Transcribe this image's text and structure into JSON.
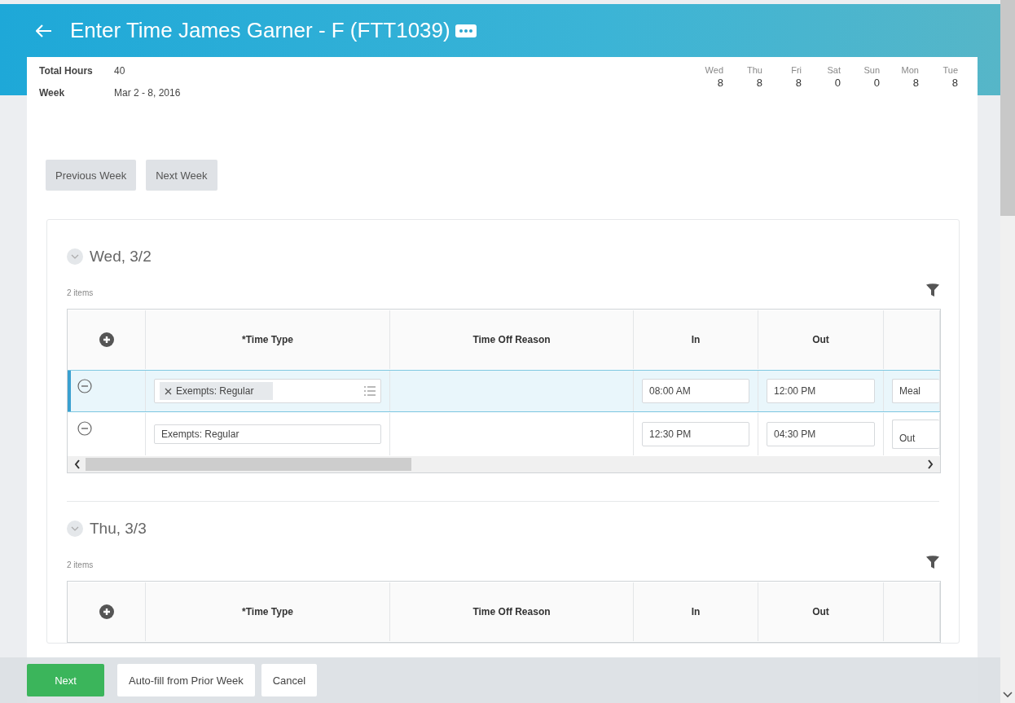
{
  "header": {
    "title": "Enter Time  James Garner - F (FTT1039)"
  },
  "summary": {
    "fields": [
      {
        "label": "Total Hours",
        "value": "40"
      },
      {
        "label": "Week",
        "value": "Mar 2 - 8, 2016"
      }
    ],
    "days": [
      {
        "day": "Wed",
        "hours": "8"
      },
      {
        "day": "Thu",
        "hours": "8"
      },
      {
        "day": "Fri",
        "hours": "8"
      },
      {
        "day": "Sat",
        "hours": "0"
      },
      {
        "day": "Sun",
        "hours": "0"
      },
      {
        "day": "Mon",
        "hours": "8"
      },
      {
        "day": "Tue",
        "hours": "8"
      }
    ]
  },
  "week_buttons": [
    "Previous Week",
    "Next Week"
  ],
  "sections": [
    {
      "day": "Wed, 3/2",
      "count": "2 items",
      "columns": [
        "*Time Type",
        "Time Off Reason",
        "In",
        "Out"
      ],
      "rows": [
        {
          "selected": true,
          "kind": "chip",
          "time_type": "Exempts: Regular",
          "in": "08:00 AM",
          "out": "12:00 PM",
          "column_6": "Meal"
        },
        {
          "selected": false,
          "kind": "text",
          "time_type": "Exempts: Regular",
          "in": "12:30 PM",
          "out": "04:30 PM",
          "column_6": "Out"
        }
      ]
    },
    {
      "day": "Thu, 3/3",
      "count": "2 items",
      "columns": [
        "*Time Type",
        "Time Off Reason",
        "In",
        "Out"
      ]
    }
  ],
  "footer": {
    "buttons": [
      {
        "label": "Next",
        "kind": "primary"
      },
      {
        "label": "Auto-fill from Prior Week",
        "kind": "secondary"
      },
      {
        "label": "Cancel",
        "kind": "secondary"
      }
    ]
  }
}
